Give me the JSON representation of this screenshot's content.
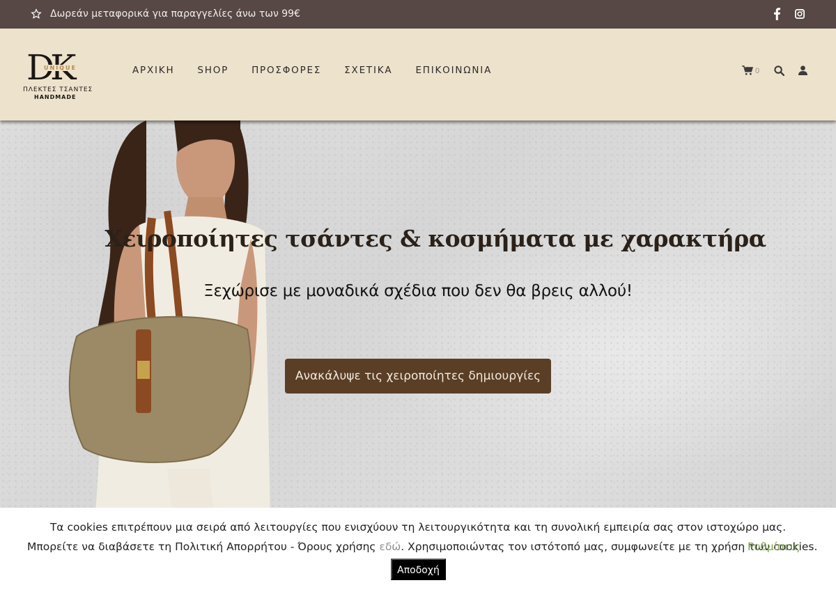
{
  "topbar": {
    "promo": "Δωρεάν μεταφορικά για παραγγελίες άνω των 99€",
    "icons": [
      "star-icon",
      "facebook-icon",
      "instagram-icon"
    ]
  },
  "logo": {
    "monogram": "DK",
    "badge": "UNIQUE",
    "line1": "ΠΛΕΚΤΕΣ ΤΣΑΝΤΕΣ",
    "line2": "HANDMADE"
  },
  "nav": {
    "items": [
      "ΑΡΧΙΚΗ",
      "SHOP",
      "ΠΡΟΣΦΟΡΕΣ",
      "ΣΧΕΤΙΚΑ",
      "ΕΠΙΚΟΙΝΩΝΙΑ"
    ]
  },
  "header_tools": {
    "cart_count": "0",
    "icons": [
      "cart-icon",
      "search-icon",
      "user-icon"
    ]
  },
  "hero": {
    "title": "Χειροποίητες τσάντες & κοσμήματα με χαρακτήρα",
    "subtitle": "Ξεχώρισε με μοναδικά σχέδια που δεν θα βρεις αλλού!",
    "cta": "Ανακάλυψε τις χειροποίητες δημιουργίες"
  },
  "cookie": {
    "line1": "Τα cookies επιτρέπουν μια σειρά από λειτουργίες που ενισχύουν τη λειτουργικότητα και τη συνολική εμπειρία σας στον ιστοχώρο μας.",
    "line2_before": "Μπορείτε να διαβάσετε τη Πολιτική Απορρήτου - Όρους χρήσης ",
    "line2_link": "εδώ",
    "line2_after": ". Χρησιμοποιώντας τον ιστότοπό μας, συμφωνείτε με τη χρήση των cookies.",
    "settings": "Ρυθμίσεις",
    "accept": "Αποδοχή"
  },
  "colors": {
    "topbar": "#574846",
    "header": "#ede2cc",
    "cta": "#5a3e26",
    "settings_link": "#7da44c"
  }
}
